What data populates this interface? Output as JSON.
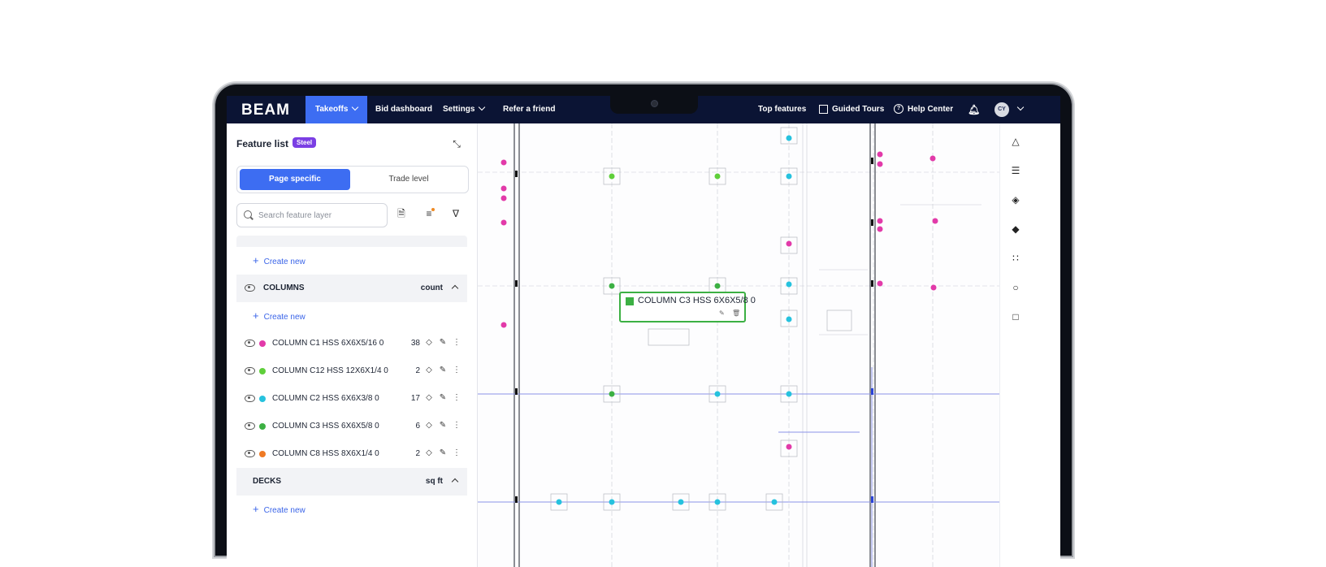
{
  "nav": {
    "logo": "BEAM",
    "tabs": [
      {
        "label": "Takeoffs",
        "active": true
      },
      {
        "label": "Bid dashboard"
      },
      {
        "label": "Settings"
      },
      {
        "label": "Refer a friend"
      }
    ],
    "right": {
      "top_features": "Top features",
      "guided_tours": "Guided Tours",
      "help_center": "Help Center",
      "avatar": "CY"
    }
  },
  "sidebar": {
    "title": "Feature list",
    "badge": "Steel",
    "toggle": {
      "page_specific": "Page specific",
      "trade_level": "Trade level"
    },
    "search_placeholder": "Search feature layer",
    "create_new": "Create new",
    "groups": [
      {
        "name": "COLUMNS",
        "unit": "count",
        "items": [
          {
            "name": "COLUMN C1 HSS 6X6X5/16 0",
            "count": "38",
            "color": "#e23aa9"
          },
          {
            "name": "COLUMN C12 HSS 12X6X1/4 0",
            "count": "2",
            "color": "#5fcf3a"
          },
          {
            "name": "COLUMN C2 HSS 6X6X3/8 0",
            "count": "17",
            "color": "#26c2de"
          },
          {
            "name": "COLUMN C3 HSS 6X6X5/8 0",
            "count": "6",
            "color": "#3cb043"
          },
          {
            "name": "COLUMN C8 HSS 8X6X1/4 0",
            "count": "2",
            "color": "#ef7a24"
          }
        ]
      },
      {
        "name": "DECKS",
        "unit": "sq ft",
        "items": []
      }
    ]
  },
  "tooltip": {
    "label": "COLUMN C3 HSS 6X6X5/8 0",
    "color": "#3cb043"
  },
  "colors": {
    "nav_bg": "#0b1434",
    "accent": "#3d6df2",
    "badge": "#7b3fe4"
  }
}
